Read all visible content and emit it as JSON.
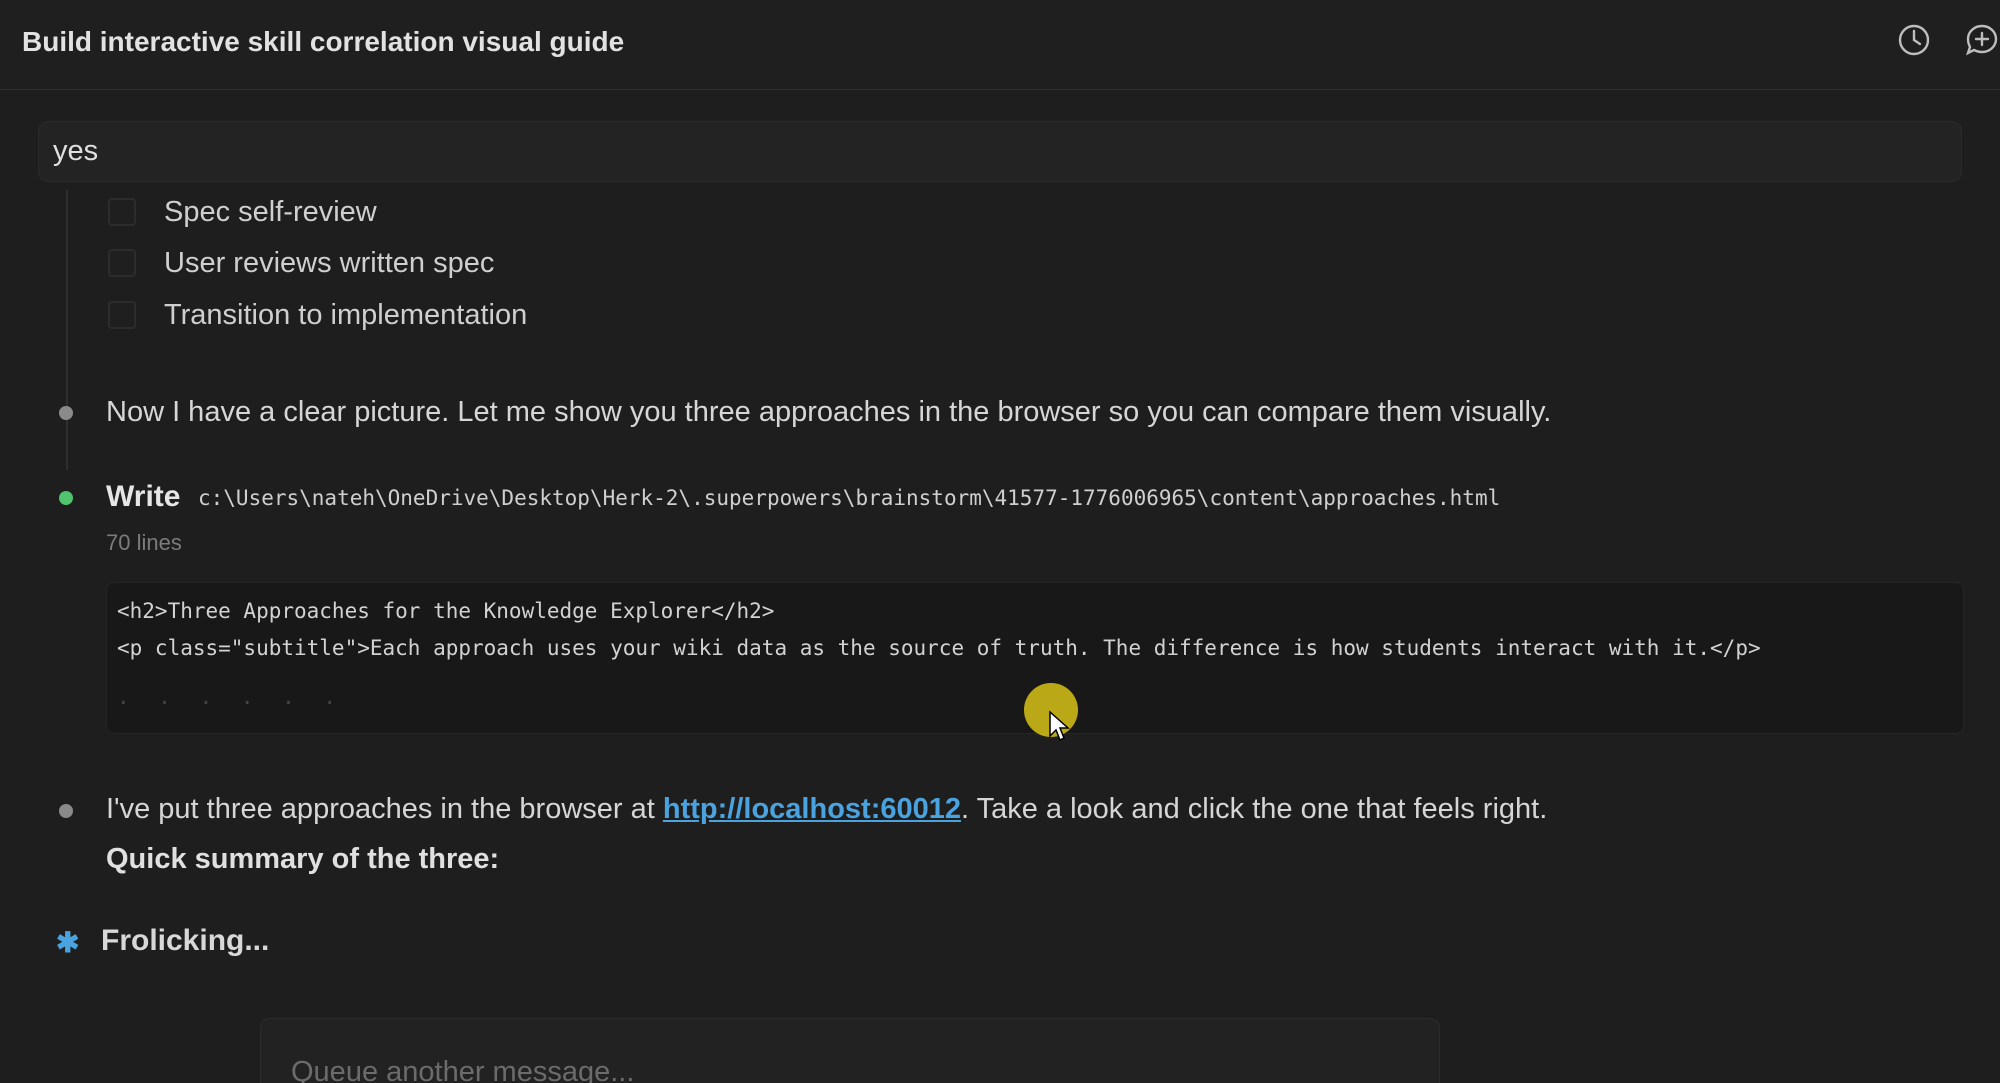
{
  "header": {
    "title": "Build interactive skill correlation visual guide",
    "icons": [
      "history-icon",
      "new-chat-icon"
    ]
  },
  "prompt": {
    "text": "yes"
  },
  "checklist": [
    {
      "label": "Spec self-review",
      "checked": false
    },
    {
      "label": "User reviews written spec",
      "checked": false
    },
    {
      "label": "Transition to implementation",
      "checked": false
    }
  ],
  "messages": {
    "intro": "Now I have a clear picture. Let me show you three approaches in the browser so you can compare them visually.",
    "tool": {
      "name": "Write",
      "path": "c:\\Users\\nateh\\OneDrive\\Desktop\\Herk-2\\.superpowers\\brainstorm\\41577-1776006965\\content\\approaches.html",
      "lines": "70 lines",
      "code": [
        "<h2>Three Approaches for the Knowledge Explorer</h2>",
        "<p class=\"subtitle\">Each approach uses your wiki data as the source of truth. The difference is how students interact with it.</p>"
      ]
    },
    "result_before": "I've put three approaches in the browser at ",
    "result_link": "http://localhost:60012",
    "result_after": ". Take a look and click the one that feels right.",
    "summary_heading": "Quick summary of the three:"
  },
  "status": {
    "icon": "spinner-star-icon",
    "text": "Frolicking..."
  },
  "queue": {
    "placeholder": "Queue another message..."
  },
  "colors": {
    "background": "#1e1e1e",
    "accent_link": "#4aa3df",
    "bullet_active": "#4fc36d",
    "cursor_highlight": "#c9b517"
  }
}
